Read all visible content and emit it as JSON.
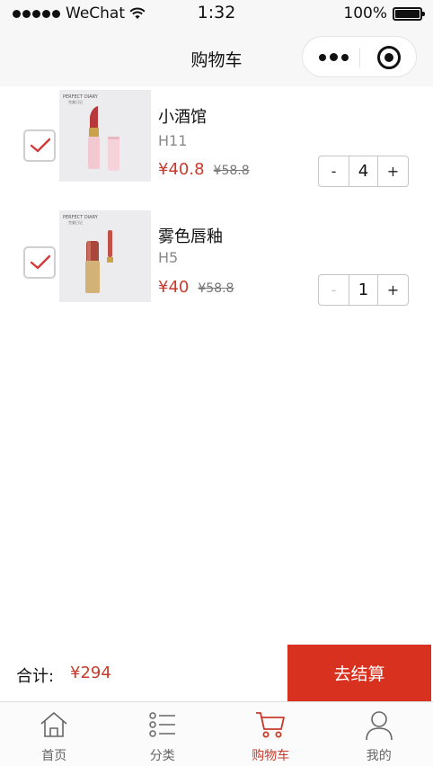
{
  "status_bar": {
    "carrier": "WeChat",
    "time": "1:32",
    "battery": "100%"
  },
  "nav": {
    "title": "购物车"
  },
  "cart": {
    "items": [
      {
        "name": "小酒馆",
        "spec": "H11",
        "price": "¥40.8",
        "original_price": "¥58.8",
        "quantity": "4",
        "checked": true,
        "decrement": "-",
        "increment": "+",
        "thumb_brand": "PERFECT DIARY",
        "thumb_sub": "完美日记"
      },
      {
        "name": "雾色唇釉",
        "spec": "H5",
        "price": "¥40",
        "original_price": "¥58.8",
        "quantity": "1",
        "checked": true,
        "decrement": "-",
        "increment": "+",
        "thumb_brand": "PERFECT DIARY",
        "thumb_sub": "完美日记"
      }
    ]
  },
  "summary": {
    "total_label": "合计:",
    "total_value": "¥294",
    "checkout_label": "去结算"
  },
  "tab_bar": {
    "tabs": [
      {
        "label": "首页",
        "icon": "home-icon",
        "active": false
      },
      {
        "label": "分类",
        "icon": "category-list-icon",
        "active": false
      },
      {
        "label": "购物车",
        "icon": "cart-icon",
        "active": true
      },
      {
        "label": "我的",
        "icon": "user-icon",
        "active": false
      }
    ]
  },
  "colors": {
    "accent": "#d9311f",
    "price": "#c93a2b",
    "check": "#d33a3a",
    "bar_bg": "#f7f7f7"
  }
}
